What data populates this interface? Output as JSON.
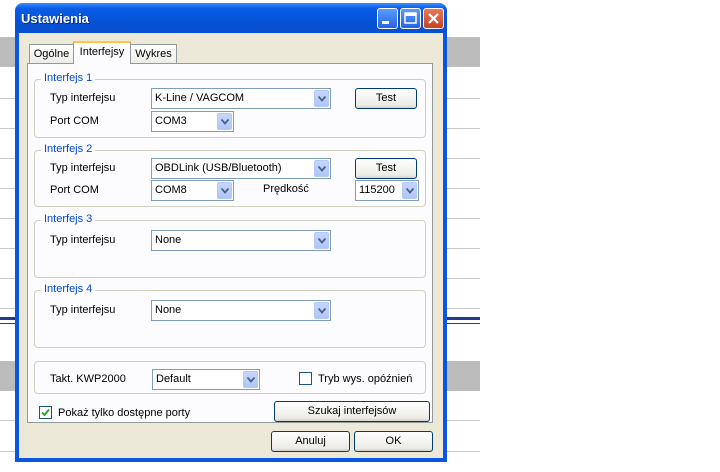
{
  "window": {
    "title": "Ustawienia"
  },
  "tabs": [
    {
      "label": "Ogólne",
      "active": false
    },
    {
      "label": "Interfejsy",
      "active": true
    },
    {
      "label": "Wykres",
      "active": false
    }
  ],
  "labels": {
    "typ_interfejsu": "Typ interfejsu",
    "port_com": "Port COM",
    "predkosc": "Prędkość"
  },
  "interfaces": [
    {
      "title": "Interfejs 1",
      "type": "K-Line / VAGCOM",
      "port": "COM3",
      "test": "Test"
    },
    {
      "title": "Interfejs 2",
      "type": "OBDLink (USB/Bluetooth)",
      "port": "COM8",
      "speed": "115200",
      "test": "Test"
    },
    {
      "title": "Interfejs 3",
      "type": "None"
    },
    {
      "title": "Interfejs 4",
      "type": "None"
    }
  ],
  "kwp": {
    "label": "Takt. KWP2000",
    "value": "Default"
  },
  "delay_mode": {
    "label": "Tryb wys. opóźnień",
    "checked": false
  },
  "show_ports": {
    "label": "Pokaż tylko dostępne porty",
    "checked": true
  },
  "buttons": {
    "search": "Szukaj interfejsów",
    "cancel": "Anuluj",
    "ok": "OK"
  },
  "colors": {
    "titlebar": "#0452d6",
    "group_title": "#0046d5",
    "face": "#ece9d8",
    "tab_accent": "#ffc83c"
  }
}
